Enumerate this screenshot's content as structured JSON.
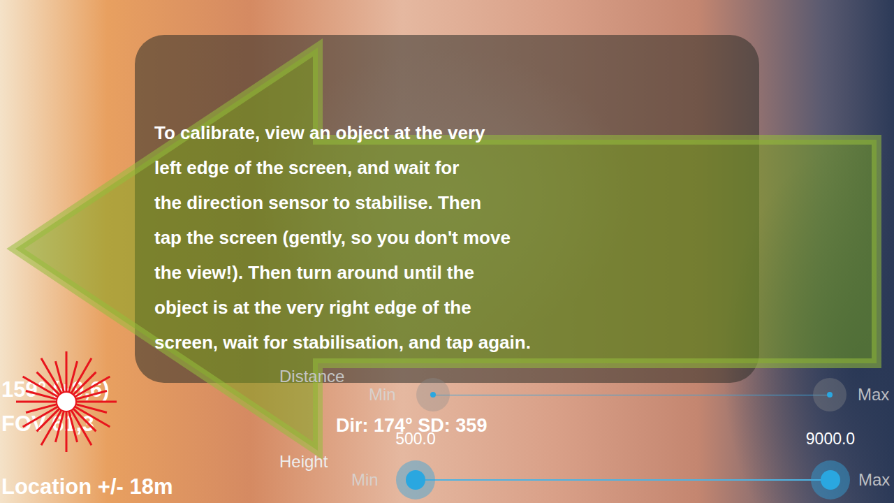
{
  "instructions": {
    "lines": [
      "To calibrate, view an object at the very",
      "left edge of the screen, and wait for",
      "the direction sensor to stabilise. Then",
      "tap the screen (gently, so you don't move",
      "the view!). Then turn around until the",
      "object is at the very right edge of the",
      "screen, wait for stabilisation, and tap again."
    ]
  },
  "hud": {
    "heading": "159° (+9,6)",
    "fov": "FOV 61,3",
    "location": "Location +/- 18m",
    "direction": "Dir: 174° SD: 359"
  },
  "sliders": [
    {
      "name": "Distance",
      "min_label": "Min",
      "max_label": "Max",
      "level_low": 0,
      "level_high": 1,
      "active": false,
      "low_reading": "",
      "high_reading": ""
    },
    {
      "name": "Height",
      "min_label": "Min",
      "max_label": "Max",
      "level_low": 0,
      "level_high": 1,
      "active": true,
      "low_reading": "500.0",
      "high_reading": "9000.0"
    }
  ]
}
